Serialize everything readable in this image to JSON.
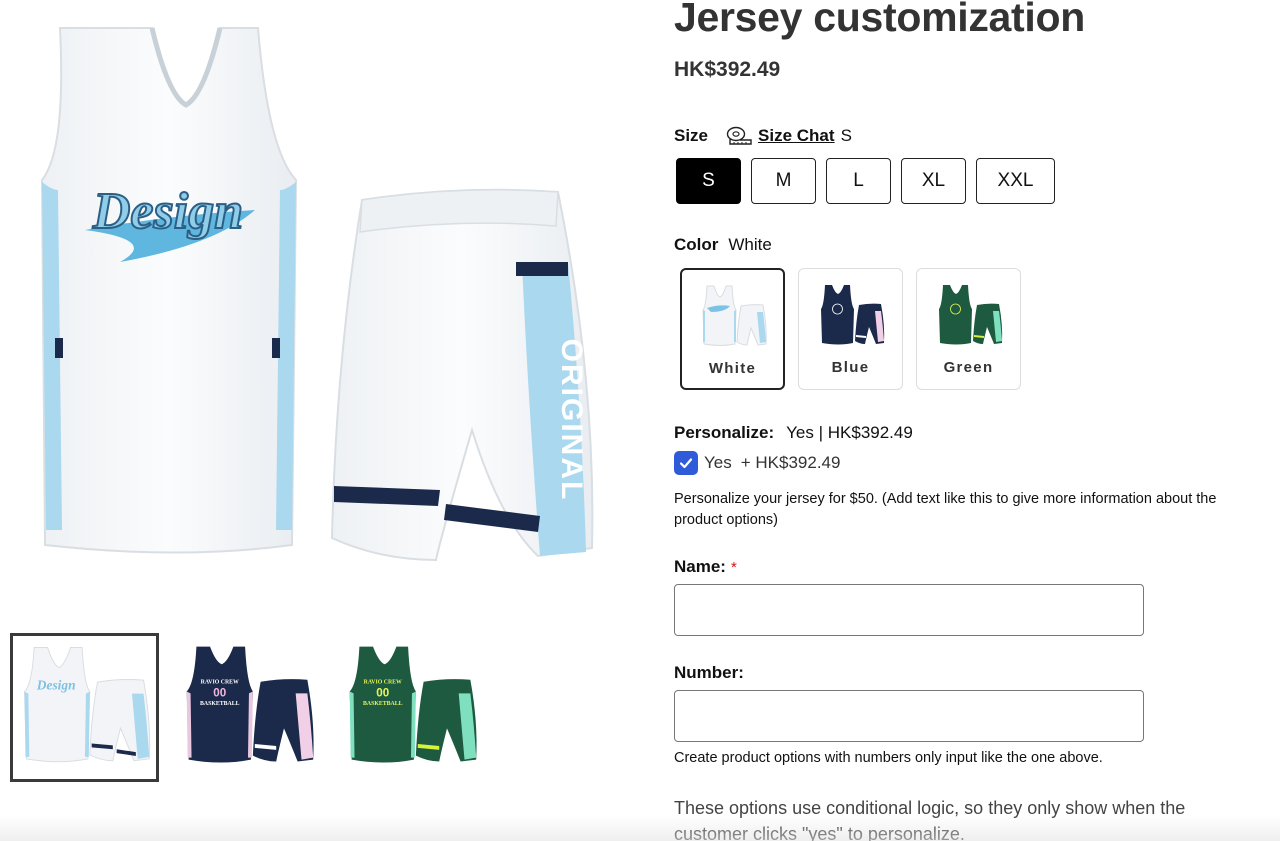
{
  "product": {
    "title": "Jersey customization",
    "price": "HK$392.49"
  },
  "gallery": {
    "main_image_alt": "White basketball jersey and shorts set",
    "main_jersey_text": "Design",
    "main_shorts_text": "ORIGINAL",
    "thumbnails": [
      {
        "name": "White",
        "selected": true
      },
      {
        "name": "Blue",
        "selected": false
      },
      {
        "name": "Green",
        "selected": false
      }
    ],
    "thumb_jersey_text": "Design",
    "thumb_blue_line1": "RAVIO CREW",
    "thumb_blue_number": "00",
    "thumb_blue_line2": "BASKETBALL",
    "thumb_green_line1": "RAVIO CREW",
    "thumb_green_number": "00",
    "thumb_green_line2": "BASKETBALL"
  },
  "size": {
    "label": "Size",
    "chart_link": "Size Chat",
    "selected": "S",
    "options": [
      "S",
      "M",
      "L",
      "XL",
      "XXL"
    ]
  },
  "color": {
    "label": "Color",
    "selected": "White",
    "options": [
      "White",
      "Blue",
      "Green"
    ]
  },
  "personalize": {
    "label": "Personalize:",
    "value": "Yes | HK$392.49",
    "checkbox_label": "Yes",
    "checkbox_price": "+ HK$392.49",
    "checked": true,
    "description": "Personalize your jersey for $50. (Add text like this to give more information about the product options)"
  },
  "fields": {
    "name_label": "Name:",
    "name_required": "*",
    "number_label": "Number:",
    "number_hint": "Create product options with numbers only input like the one above."
  },
  "logic_note": "These options use conditional logic, so they only show when the customer clicks \"yes\" to personalize.",
  "colors": {
    "jersey_white": "#f4f6f8",
    "sky_blue": "#a9d8ef",
    "navy": "#1b2a4a",
    "green": "#1d5a3f",
    "checkbox_blue": "#2f5bd8"
  }
}
